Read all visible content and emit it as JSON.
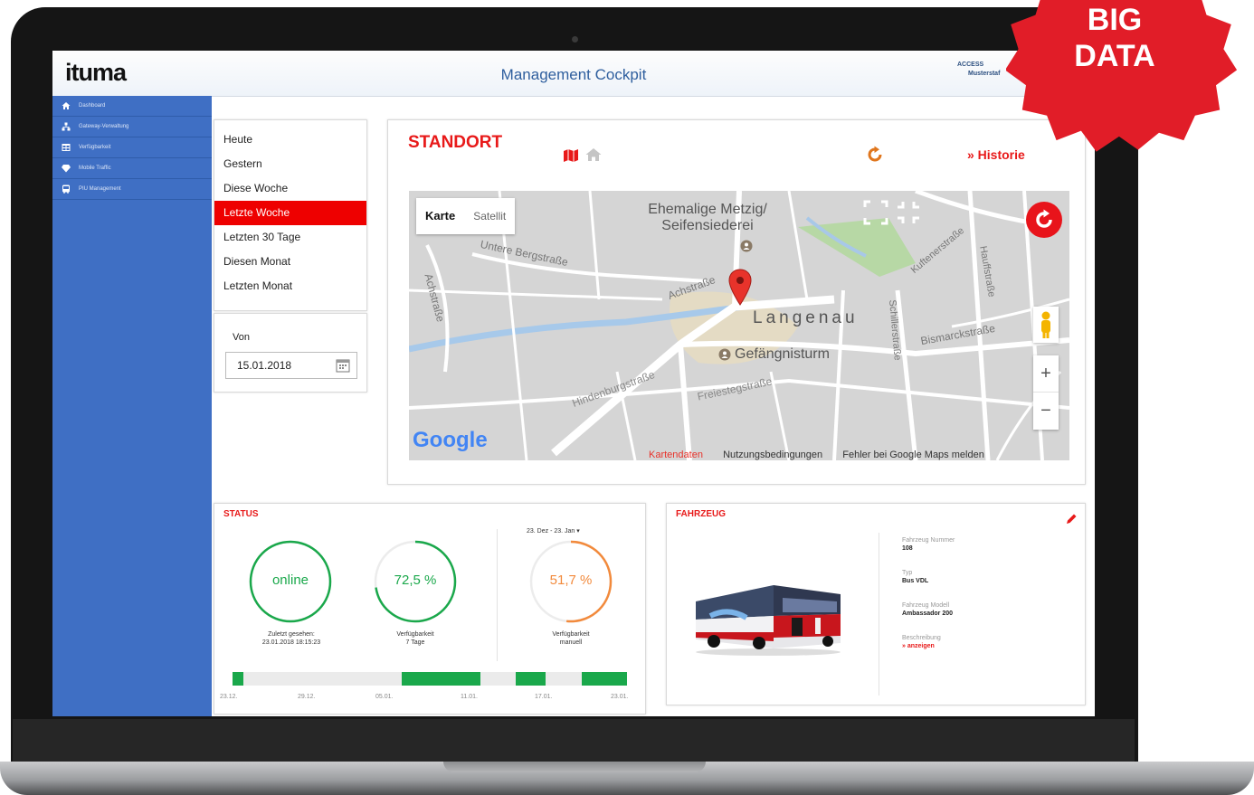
{
  "header": {
    "logo": "ituma",
    "title": "Management Cockpit",
    "access_line1": "ACCESS",
    "access_line2": "Musterstaf"
  },
  "sidebar": {
    "items": [
      {
        "label": "Dashboard",
        "icon": "home-icon"
      },
      {
        "label": "Gateway-Verwaltung",
        "icon": "sitemap-icon"
      },
      {
        "label": "Verfügbarkeit",
        "icon": "table-icon"
      },
      {
        "label": "Mobile Traffic",
        "icon": "diamond-icon"
      },
      {
        "label": "PIU Management",
        "icon": "bus-icon"
      }
    ]
  },
  "periods": {
    "items": [
      "Heute",
      "Gestern",
      "Diese Woche",
      "Letzte Woche",
      "Letzten 30 Tage",
      "Diesen Monat",
      "Letzten Monat"
    ],
    "active": "Letzte Woche"
  },
  "from": {
    "label": "Von",
    "value": "15.01.2018"
  },
  "standort": {
    "title": "STANDORT",
    "historie": "» Historie"
  },
  "map": {
    "type_map": "Karte",
    "type_satellite": "Satellit",
    "labels": {
      "poi_title_1": "Ehemalige Metzig/",
      "poi_title_2": "Seifensiederei",
      "town": "Langenau",
      "poi_tower": "Gefängnisturm",
      "street_unterebergstrasse": "Untere Bergstraße",
      "street_achstrasse_left": "Achstraße",
      "street_achstrasse": "Achstraße",
      "street_hindenburg": "Hindenburgstraße",
      "street_freiestegstrasse": "Freiestegstraße",
      "street_bismarck": "Bismarckstraße",
      "street_schiller": "Schillerstraße",
      "street_kuftener": "Kuftenerstraße",
      "street_hauff": "Hauffstraße"
    },
    "google": "Google",
    "footer_data": "Kartendaten",
    "footer_terms": "Nutzungsbedingungen",
    "footer_report": "Fehler bei Google Maps melden",
    "zoom_in": "+",
    "zoom_out": "−"
  },
  "status": {
    "title": "STATUS",
    "range": "23. Dez - 23. Jan ▾",
    "gauges": [
      {
        "value_text": "online",
        "label_line1": "Zuletzt gesehen:",
        "label_line2": "23.01.2018 18:15:23",
        "fraction": 1.0,
        "color": "#1aa84b"
      },
      {
        "value_text": "72,5 %",
        "label_line1": "Verfügbarkeit",
        "label_line2": "7 Tage",
        "fraction": 0.725,
        "color": "#1aa84b"
      },
      {
        "value_text": "51,7 %",
        "label_line1": "Verfügbarkeit",
        "label_line2": "manuell",
        "fraction": 0.517,
        "color": "#f28a3c"
      }
    ],
    "timeline_ticks": [
      "23.12.",
      "29.12.",
      "05.01.",
      "11.01.",
      "17.01.",
      "23.01."
    ]
  },
  "fahrzeug": {
    "title": "FAHRZEUG",
    "fields": [
      {
        "label": "Fahrzeug Nummer",
        "value": "108"
      },
      {
        "label": "Typ",
        "value": "Bus VDL"
      },
      {
        "label": "Fahrzeug Modell",
        "value": "Ambassador 200"
      },
      {
        "label": "Beschreibung",
        "value": "» anzeigen"
      }
    ]
  },
  "badge": {
    "line1": "BIG",
    "line2": "DATA"
  },
  "colors": {
    "accent_red": "#e81919",
    "sidebar_blue": "#3f6fc4",
    "status_green": "#1aa84b",
    "status_orange": "#f28a3c",
    "title_blue": "#2f5f9e"
  }
}
